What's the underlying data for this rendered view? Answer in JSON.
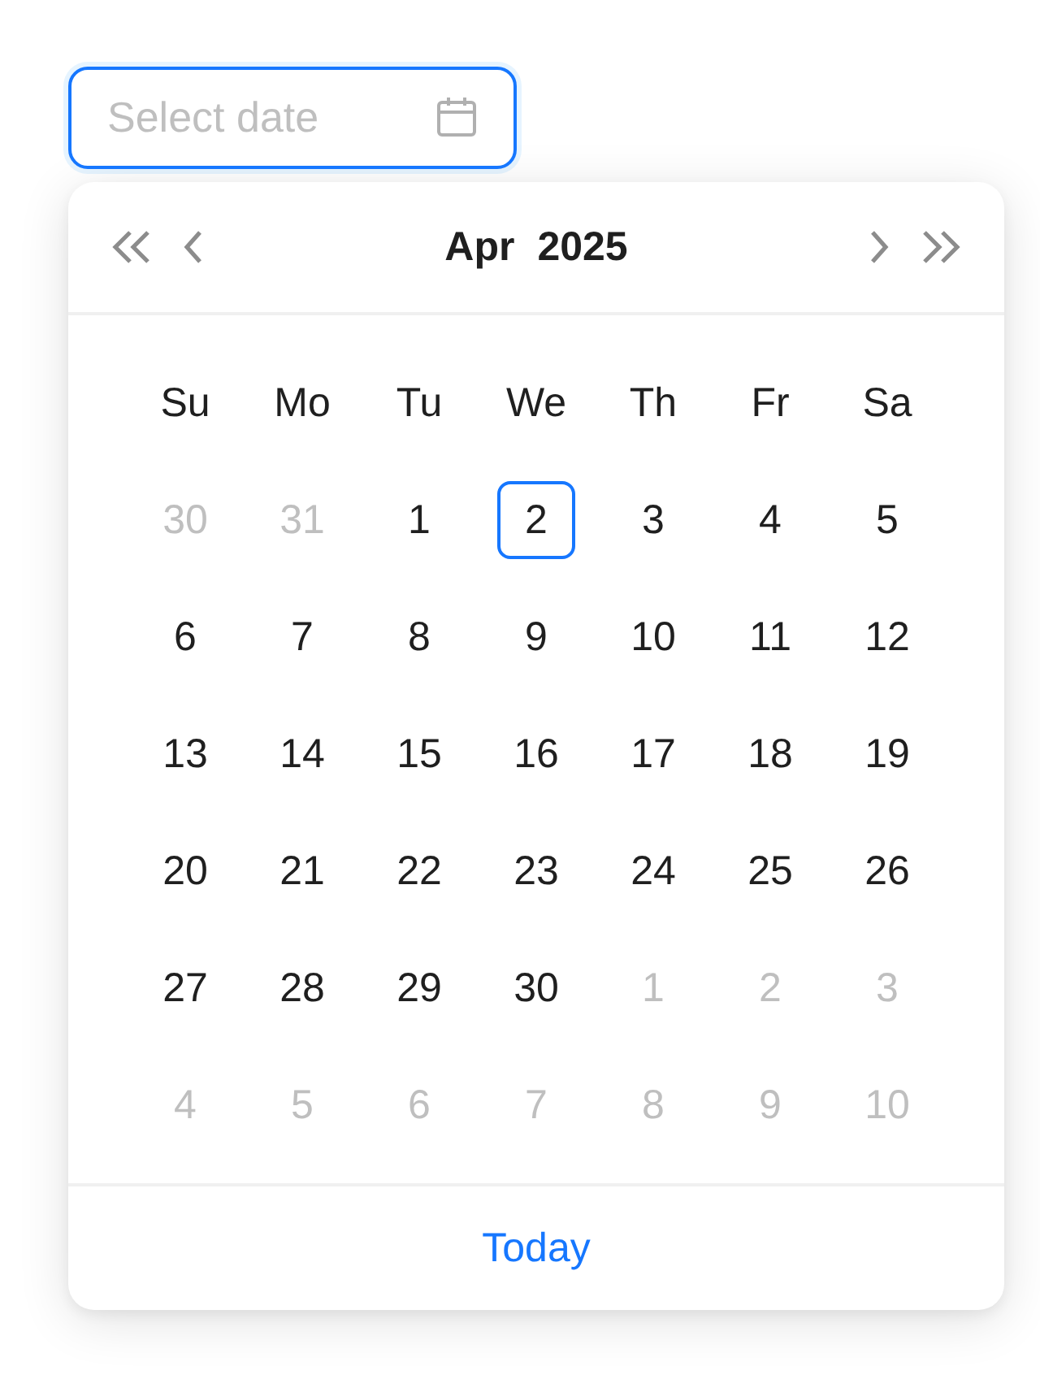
{
  "date_input": {
    "placeholder": "Select date",
    "focused": true
  },
  "calendar": {
    "month": "Apr",
    "year": "2025",
    "weekdays": [
      "Su",
      "Mo",
      "Tu",
      "We",
      "Th",
      "Fr",
      "Sa"
    ],
    "weeks": [
      [
        {
          "label": "30",
          "in_month": false,
          "today": false
        },
        {
          "label": "31",
          "in_month": false,
          "today": false
        },
        {
          "label": "1",
          "in_month": true,
          "today": false
        },
        {
          "label": "2",
          "in_month": true,
          "today": true
        },
        {
          "label": "3",
          "in_month": true,
          "today": false
        },
        {
          "label": "4",
          "in_month": true,
          "today": false
        },
        {
          "label": "5",
          "in_month": true,
          "today": false
        }
      ],
      [
        {
          "label": "6",
          "in_month": true,
          "today": false
        },
        {
          "label": "7",
          "in_month": true,
          "today": false
        },
        {
          "label": "8",
          "in_month": true,
          "today": false
        },
        {
          "label": "9",
          "in_month": true,
          "today": false
        },
        {
          "label": "10",
          "in_month": true,
          "today": false
        },
        {
          "label": "11",
          "in_month": true,
          "today": false
        },
        {
          "label": "12",
          "in_month": true,
          "today": false
        }
      ],
      [
        {
          "label": "13",
          "in_month": true,
          "today": false
        },
        {
          "label": "14",
          "in_month": true,
          "today": false
        },
        {
          "label": "15",
          "in_month": true,
          "today": false
        },
        {
          "label": "16",
          "in_month": true,
          "today": false
        },
        {
          "label": "17",
          "in_month": true,
          "today": false
        },
        {
          "label": "18",
          "in_month": true,
          "today": false
        },
        {
          "label": "19",
          "in_month": true,
          "today": false
        }
      ],
      [
        {
          "label": "20",
          "in_month": true,
          "today": false
        },
        {
          "label": "21",
          "in_month": true,
          "today": false
        },
        {
          "label": "22",
          "in_month": true,
          "today": false
        },
        {
          "label": "23",
          "in_month": true,
          "today": false
        },
        {
          "label": "24",
          "in_month": true,
          "today": false
        },
        {
          "label": "25",
          "in_month": true,
          "today": false
        },
        {
          "label": "26",
          "in_month": true,
          "today": false
        }
      ],
      [
        {
          "label": "27",
          "in_month": true,
          "today": false
        },
        {
          "label": "28",
          "in_month": true,
          "today": false
        },
        {
          "label": "29",
          "in_month": true,
          "today": false
        },
        {
          "label": "30",
          "in_month": true,
          "today": false
        },
        {
          "label": "1",
          "in_month": false,
          "today": false
        },
        {
          "label": "2",
          "in_month": false,
          "today": false
        },
        {
          "label": "3",
          "in_month": false,
          "today": false
        }
      ],
      [
        {
          "label": "4",
          "in_month": false,
          "today": false
        },
        {
          "label": "5",
          "in_month": false,
          "today": false
        },
        {
          "label": "6",
          "in_month": false,
          "today": false
        },
        {
          "label": "7",
          "in_month": false,
          "today": false
        },
        {
          "label": "8",
          "in_month": false,
          "today": false
        },
        {
          "label": "9",
          "in_month": false,
          "today": false
        },
        {
          "label": "10",
          "in_month": false,
          "today": false
        }
      ]
    ],
    "footer_link": "Today"
  }
}
